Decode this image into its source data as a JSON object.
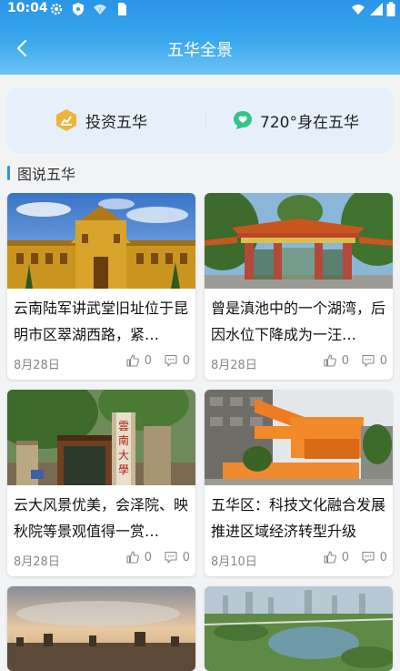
{
  "status": {
    "time": "10:04"
  },
  "header": {
    "title": "五华全景"
  },
  "quick_links": [
    {
      "label": "投资五华",
      "icon": "hexagon-gold-icon",
      "color": "#f2b33d"
    },
    {
      "label": "720°身在五华",
      "icon": "chat-bubble-green-icon",
      "color": "#33c48b"
    }
  ],
  "section": {
    "title": "图说五华"
  },
  "cards": [
    {
      "text": "云南陆军讲武堂旧址位于昆明市区翠湖西路，紧…",
      "date": "8月28日",
      "likes": "0",
      "comments": "0"
    },
    {
      "text": "曾是滇池中的一个湖湾，后因水位下降成为一汪…",
      "date": "8月28日",
      "likes": "0",
      "comments": "0"
    },
    {
      "text": "云大风景优美，会泽院、映秋院等景观值得一赏…",
      "date": "8月28日",
      "likes": "0",
      "comments": "0"
    },
    {
      "text": "五华区：科技文化融合发展推进区域经济转型升级",
      "date": "8月10日",
      "likes": "0",
      "comments": "0"
    },
    {
      "text": "",
      "date": "",
      "likes": "",
      "comments": ""
    },
    {
      "text": "",
      "date": "",
      "likes": "",
      "comments": ""
    }
  ],
  "colors": {
    "accent": "#2a95e8",
    "background": "#f2f3f5"
  }
}
